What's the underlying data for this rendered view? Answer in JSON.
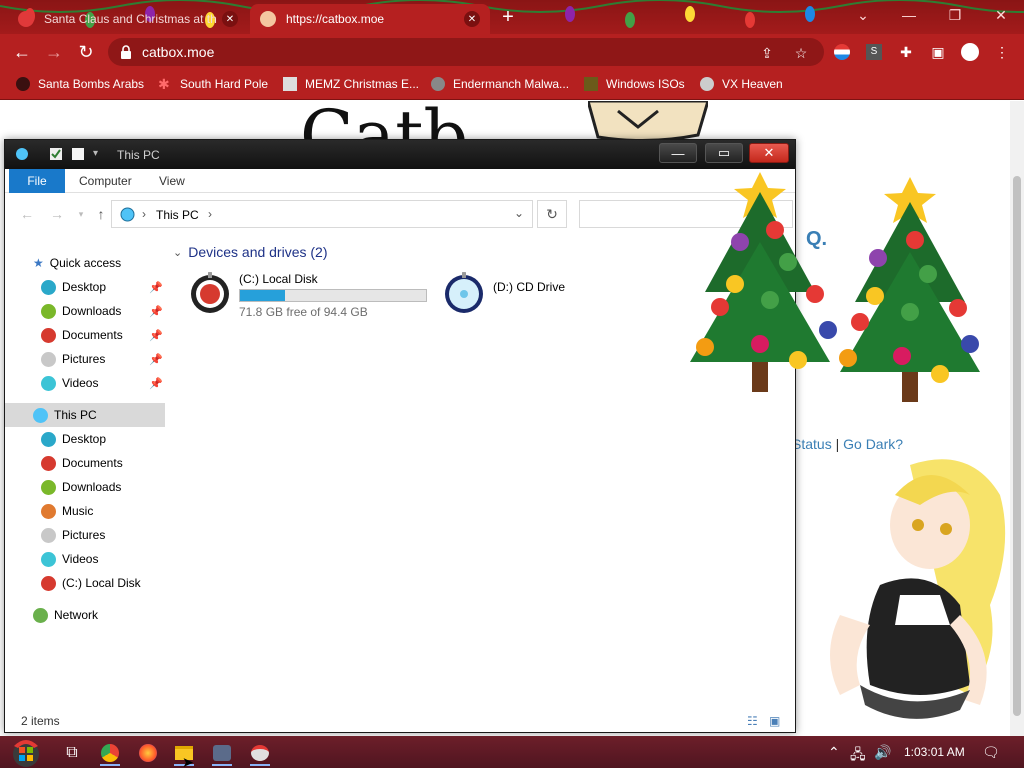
{
  "browser": {
    "tabs": [
      {
        "title": "Santa Claus and Christmas at th",
        "active": false
      },
      {
        "title": "https://catbox.moe",
        "active": true
      }
    ],
    "new_tab_icon": "plus-icon",
    "url": "catbox.moe",
    "bookmarks": [
      {
        "label": "Santa Bombs Arabs"
      },
      {
        "label": "South Hard Pole"
      },
      {
        "label": "MEMZ Christmas E..."
      },
      {
        "label": "Endermanch Malwa..."
      },
      {
        "label": "Windows ISOs"
      },
      {
        "label": "VX Heaven"
      }
    ],
    "accent_color": "#b52020"
  },
  "page": {
    "logo_partial": "Catb",
    "faq_partial": "Q.",
    "link_status": "Status",
    "link_separator": "|",
    "link_dark": "Go Dark?"
  },
  "explorer": {
    "title": "This PC",
    "ribbon_tabs": [
      "File",
      "Computer",
      "View"
    ],
    "address": "This PC",
    "nav": {
      "quick_access": "Quick access",
      "quick_items": [
        {
          "label": "Desktop",
          "color": "#2aa8c9"
        },
        {
          "label": "Downloads",
          "color": "#7ab82a"
        },
        {
          "label": "Documents",
          "color": "#d63a2f"
        },
        {
          "label": "Pictures",
          "color": "#c8c8c8"
        },
        {
          "label": "Videos",
          "color": "#3cc4d6"
        }
      ],
      "this_pc": "This PC",
      "pc_items": [
        {
          "label": "Desktop",
          "color": "#2aa8c9"
        },
        {
          "label": "Documents",
          "color": "#d63a2f"
        },
        {
          "label": "Downloads",
          "color": "#7ab82a"
        },
        {
          "label": "Music",
          "color": "#e07a30"
        },
        {
          "label": "Pictures",
          "color": "#c8c8c8"
        },
        {
          "label": "Videos",
          "color": "#3cc4d6"
        },
        {
          "label": "(C:) Local Disk",
          "color": "#d63a2f"
        }
      ],
      "network": "Network"
    },
    "group_header": "Devices and drives (2)",
    "drives": [
      {
        "name": "(C:) Local Disk",
        "free_text": "71.8 GB free of 94.4 GB",
        "used_fraction": 0.24
      },
      {
        "name": "(D:) CD Drive"
      }
    ],
    "status": "2 items"
  },
  "taskbar": {
    "clock": "1:03:01 AM",
    "apps": [
      "task-view-icon",
      "chrome-icon",
      "firefox-icon",
      "file-explorer-icon",
      "app-icon",
      "app-icon-2"
    ]
  }
}
